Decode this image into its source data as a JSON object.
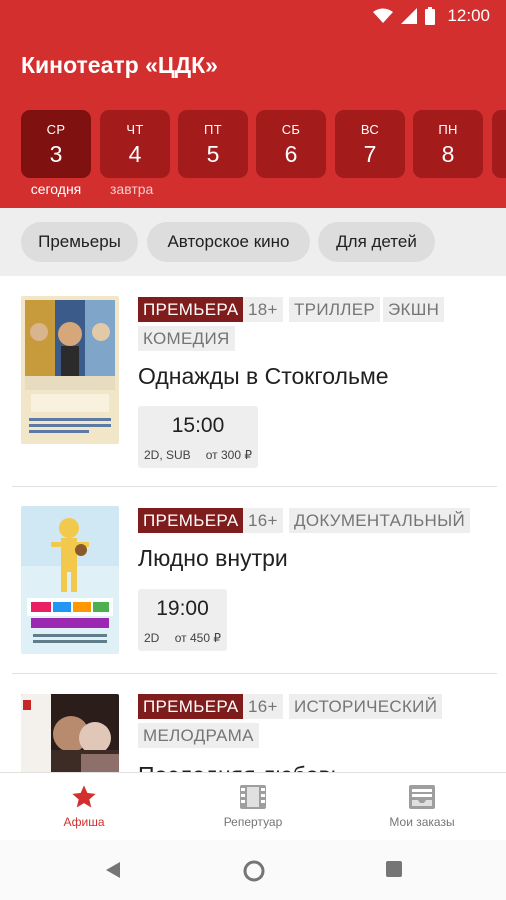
{
  "status_bar": {
    "time": "12:00"
  },
  "app": {
    "title": "Кинотеатр «ЦДК»"
  },
  "dates": [
    {
      "dow": "СР",
      "num": "3",
      "caption": "сегодня",
      "active": true
    },
    {
      "dow": "ЧТ",
      "num": "4",
      "caption": "завтра",
      "active": false
    },
    {
      "dow": "ПТ",
      "num": "5",
      "caption": "",
      "active": false
    },
    {
      "dow": "СБ",
      "num": "6",
      "caption": "",
      "active": false
    },
    {
      "dow": "ВС",
      "num": "7",
      "caption": "",
      "active": false
    },
    {
      "dow": "ПН",
      "num": "8",
      "caption": "",
      "active": false
    }
  ],
  "filters": [
    "Премьеры",
    "Авторское кино",
    "Для детей"
  ],
  "movies": [
    {
      "tags": [
        "ПРЕМЬЕРА",
        "18+",
        "ТРИЛЛЕР",
        "ЭКШН",
        "КОМЕДИЯ"
      ],
      "title": "Однажды в Стокгольме",
      "poster_text": "ОДНАЖДЫ В СТОКГОЛЬМЕ",
      "sessions": [
        {
          "time": "15:00",
          "format": "2D, SUB",
          "price": "от 300 ₽"
        }
      ]
    },
    {
      "tags": [
        "ПРЕМЬЕРА",
        "16+",
        "ДОКУМЕНТАЛЬНЫЙ"
      ],
      "title": "Людно внутри",
      "poster_text": "ЛЮДНО ВНУТРИ",
      "sessions": [
        {
          "time": "19:00",
          "format": "2D",
          "price": "от 450 ₽"
        }
      ]
    },
    {
      "tags": [
        "ПРЕМЬЕРА",
        "16+",
        "ИСТОРИЧЕСКИЙ",
        "МЕЛОДРАМА"
      ],
      "title": "Последняя любовь",
      "sessions": []
    }
  ],
  "bottom_nav": [
    {
      "label": "Афиша",
      "icon": "star-icon",
      "active": true
    },
    {
      "label": "Репертуар",
      "icon": "film-icon",
      "active": false
    },
    {
      "label": "Мои заказы",
      "icon": "inbox-icon",
      "active": false
    }
  ],
  "colors": {
    "primary": "#d32f2f",
    "date_box": "#a31b1b",
    "date_box_active": "#7f1111",
    "premiere_tag": "#7f1d1d"
  }
}
